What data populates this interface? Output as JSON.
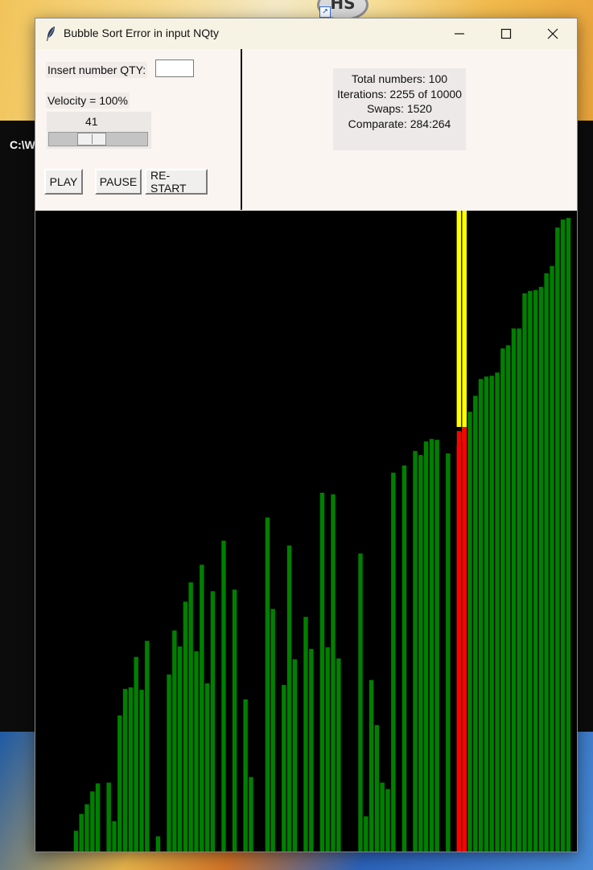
{
  "desktop": {
    "icon_label": "HS",
    "console_title": "C:\\W"
  },
  "window": {
    "title": "Bubble Sort Error in input NQty",
    "icon": "feather-icon",
    "controls": {
      "minimize": "minimize-icon",
      "maximize": "maximize-icon",
      "close": "close-icon"
    }
  },
  "controls": {
    "qty_label": "Insert number QTY:",
    "qty_value": "",
    "velocity_label": "Velocity = 100%",
    "scale_value": "41",
    "scale_fraction": 0.41,
    "play_label": "PLAY",
    "pause_label": "PAUSE",
    "restart_label": "RE-START"
  },
  "stats": {
    "total": "Total numbers: 100",
    "iterations": "Iterations: 2255 of 10000",
    "swaps": "Swaps: 1520",
    "comparate": "Comparate: 284:264"
  },
  "colors": {
    "bar_default": "#008000",
    "bar_compare_a": "#ff0000",
    "bar_compare_b": "#ffff00",
    "canvas_bg": "#000000"
  },
  "chart_data": {
    "type": "bar",
    "bar_count": 100,
    "ylim": [
      0,
      800
    ],
    "compare_indices": [
      77,
      78
    ],
    "values": [
      0,
      0,
      0,
      0,
      0,
      0,
      0,
      26,
      47,
      59,
      75,
      85,
      0,
      86,
      38,
      170,
      203,
      205,
      243,
      202,
      263,
      0,
      19,
      0,
      221,
      276,
      256,
      312,
      336,
      250,
      358,
      210,
      325,
      0,
      388,
      0,
      327,
      0,
      190,
      93,
      0,
      0,
      417,
      303,
      0,
      208,
      382,
      240,
      0,
      293,
      253,
      0,
      448,
      255,
      446,
      241,
      0,
      0,
      0,
      372,
      44,
      214,
      158,
      86,
      78,
      473,
      0,
      482,
      0,
      500,
      495,
      512,
      515,
      514,
      0,
      497,
      0,
      525,
      530,
      549,
      569,
      590,
      593,
      594,
      598,
      628,
      632,
      653,
      653,
      697,
      700,
      701,
      705,
      722,
      731,
      779,
      789,
      791,
      0,
      0
    ]
  }
}
